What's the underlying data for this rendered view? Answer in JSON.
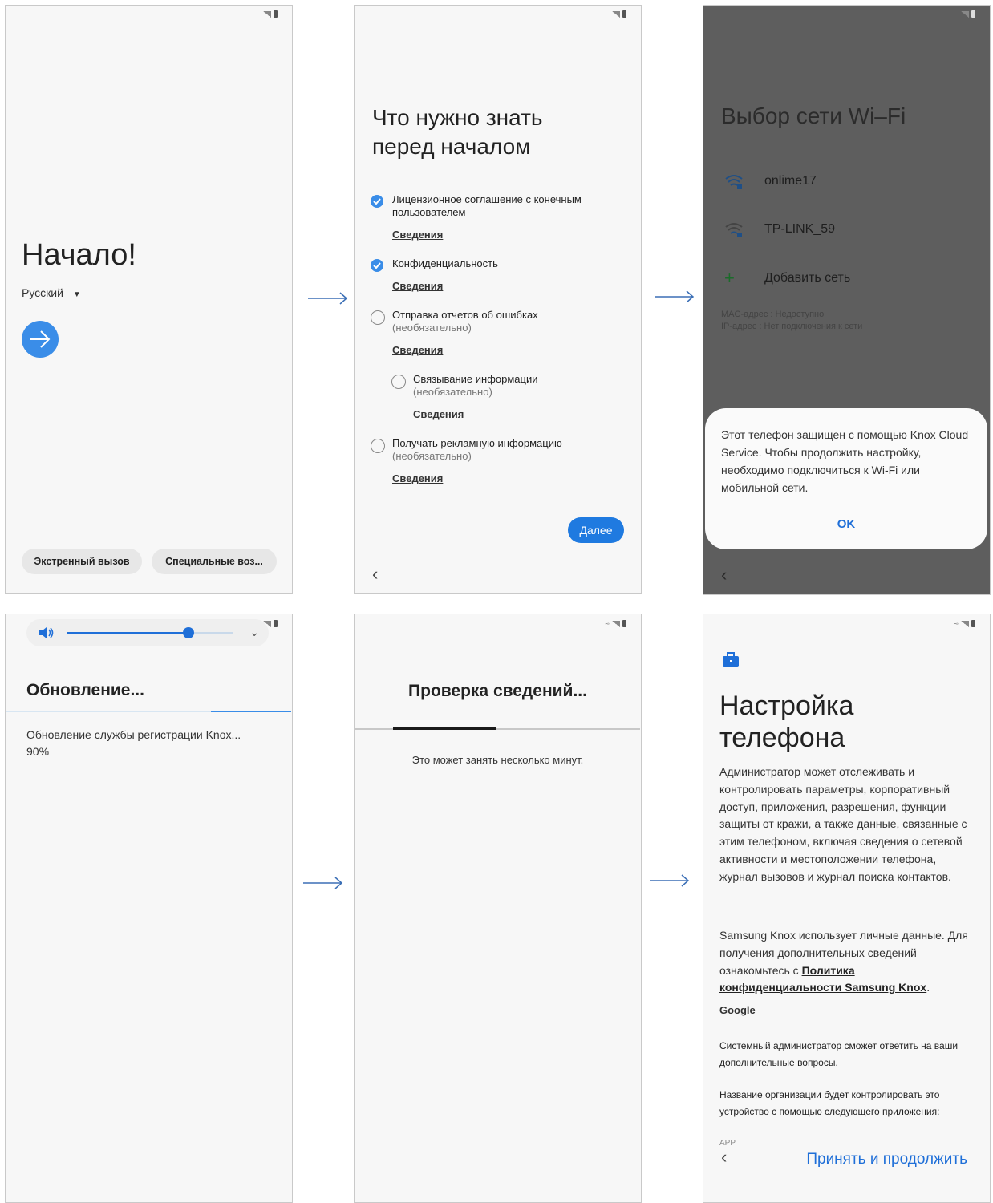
{
  "screen1": {
    "title": "Начало!",
    "language": "Русский",
    "emergency_label": "Экстренный вызов",
    "accessibility_label": "Специальные воз..."
  },
  "screen2": {
    "title_line1": "Что нужно знать",
    "title_line2": "перед началом",
    "items": [
      {
        "text": "Лицензионное соглашение с конечным пользователем",
        "optional": "",
        "more": "Сведения",
        "checked": true
      },
      {
        "text": "Конфиденциальность",
        "optional": "",
        "more": "Сведения",
        "checked": true
      },
      {
        "text": "Отправка отчетов об ошибках",
        "optional": "(необязательно)",
        "more": "Сведения",
        "checked": false
      },
      {
        "text": "Связывание информации",
        "optional": "(необязательно)",
        "more": "Сведения",
        "checked": false
      },
      {
        "text": "Получать рекламную информацию",
        "optional": "(необязательно)",
        "more": "Сведения",
        "checked": false
      }
    ],
    "next_label": "Далее"
  },
  "screen3": {
    "title": "Выбор сети Wi–Fi",
    "networks": [
      "onlime17",
      "TP-LINK_59"
    ],
    "add_network": "Добавить сеть",
    "mac": "MAC-адрес : Недоступно",
    "ip": "IP-адрес : Нет подключения к сети",
    "dialog_message": "Этот телефон защищен с помощью Knox Cloud Service. Чтобы продолжить настройку, необходимо подключиться к Wi-Fi или мобильной сети.",
    "ok_label": "OK"
  },
  "screen4": {
    "title": "Обновление...",
    "desc": "Обновление службы регистрации Knox...",
    "percent": "90%",
    "volume_level": 0.73
  },
  "screen5": {
    "title": "Проверка сведений...",
    "desc": "Это может занять несколько минут."
  },
  "screen6": {
    "title_line1": "Настройка",
    "title_line2": "телефона",
    "body": "Администратор может отслеживать и контролировать параметры, корпоративный доступ, приложения, разрешения, функции защиты от кражи, а также данные, связанные с этим телефоном, включая сведения о сетевой активности и местоположении телефона, журнал вызовов и журнал поиска контактов.",
    "body2_start": "Samsung Knox использует личные данные. Для получения дополнительных сведений ознакомьтесь с ",
    "policy_link": "Политика конфиденциальности Samsung Knox",
    "body2_end": ".",
    "google": "Google",
    "admin_note": "Системный администратор сможет ответить на ваши дополнительные вопросы.",
    "org_note": "Название организации будет контролировать это устройство с помощью следующего приложения:",
    "app_label": "APP",
    "accept_label": "Принять и продолжить"
  },
  "colors": {
    "accent": "#3a8de8",
    "link_blue": "#1f6fd8",
    "dim_overlay": "#5e5e5e",
    "arrow": "#3b6fb6"
  }
}
